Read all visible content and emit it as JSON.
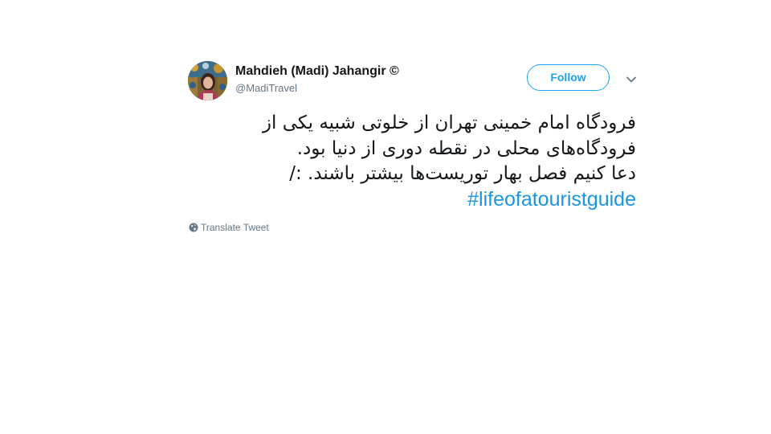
{
  "tweet": {
    "author": {
      "name": "Mahdieh (Madi) Jahangir ©",
      "handle": "@MadiTravel",
      "avatar_icon": "profile-photo"
    },
    "follow_label": "Follow",
    "menu_icon": "chevron-down-icon",
    "text_lines": [
      "فرودگاه امام خمینی تهران از خلوتی شبیه یکی از",
      "فرودگاه‌های محلی در نقطه دوری از دنیا بود.",
      "دعا کنیم فصل بهار توریست‌ها بیشتر باشند. :/"
    ],
    "hashtag": "#lifeofatouristguide",
    "translate_label": "Translate Tweet",
    "translate_icon": "globe-icon"
  },
  "colors": {
    "accent": "#1da1f2",
    "link": "#1b95e0",
    "text": "#14171a",
    "secondary": "#657786"
  }
}
